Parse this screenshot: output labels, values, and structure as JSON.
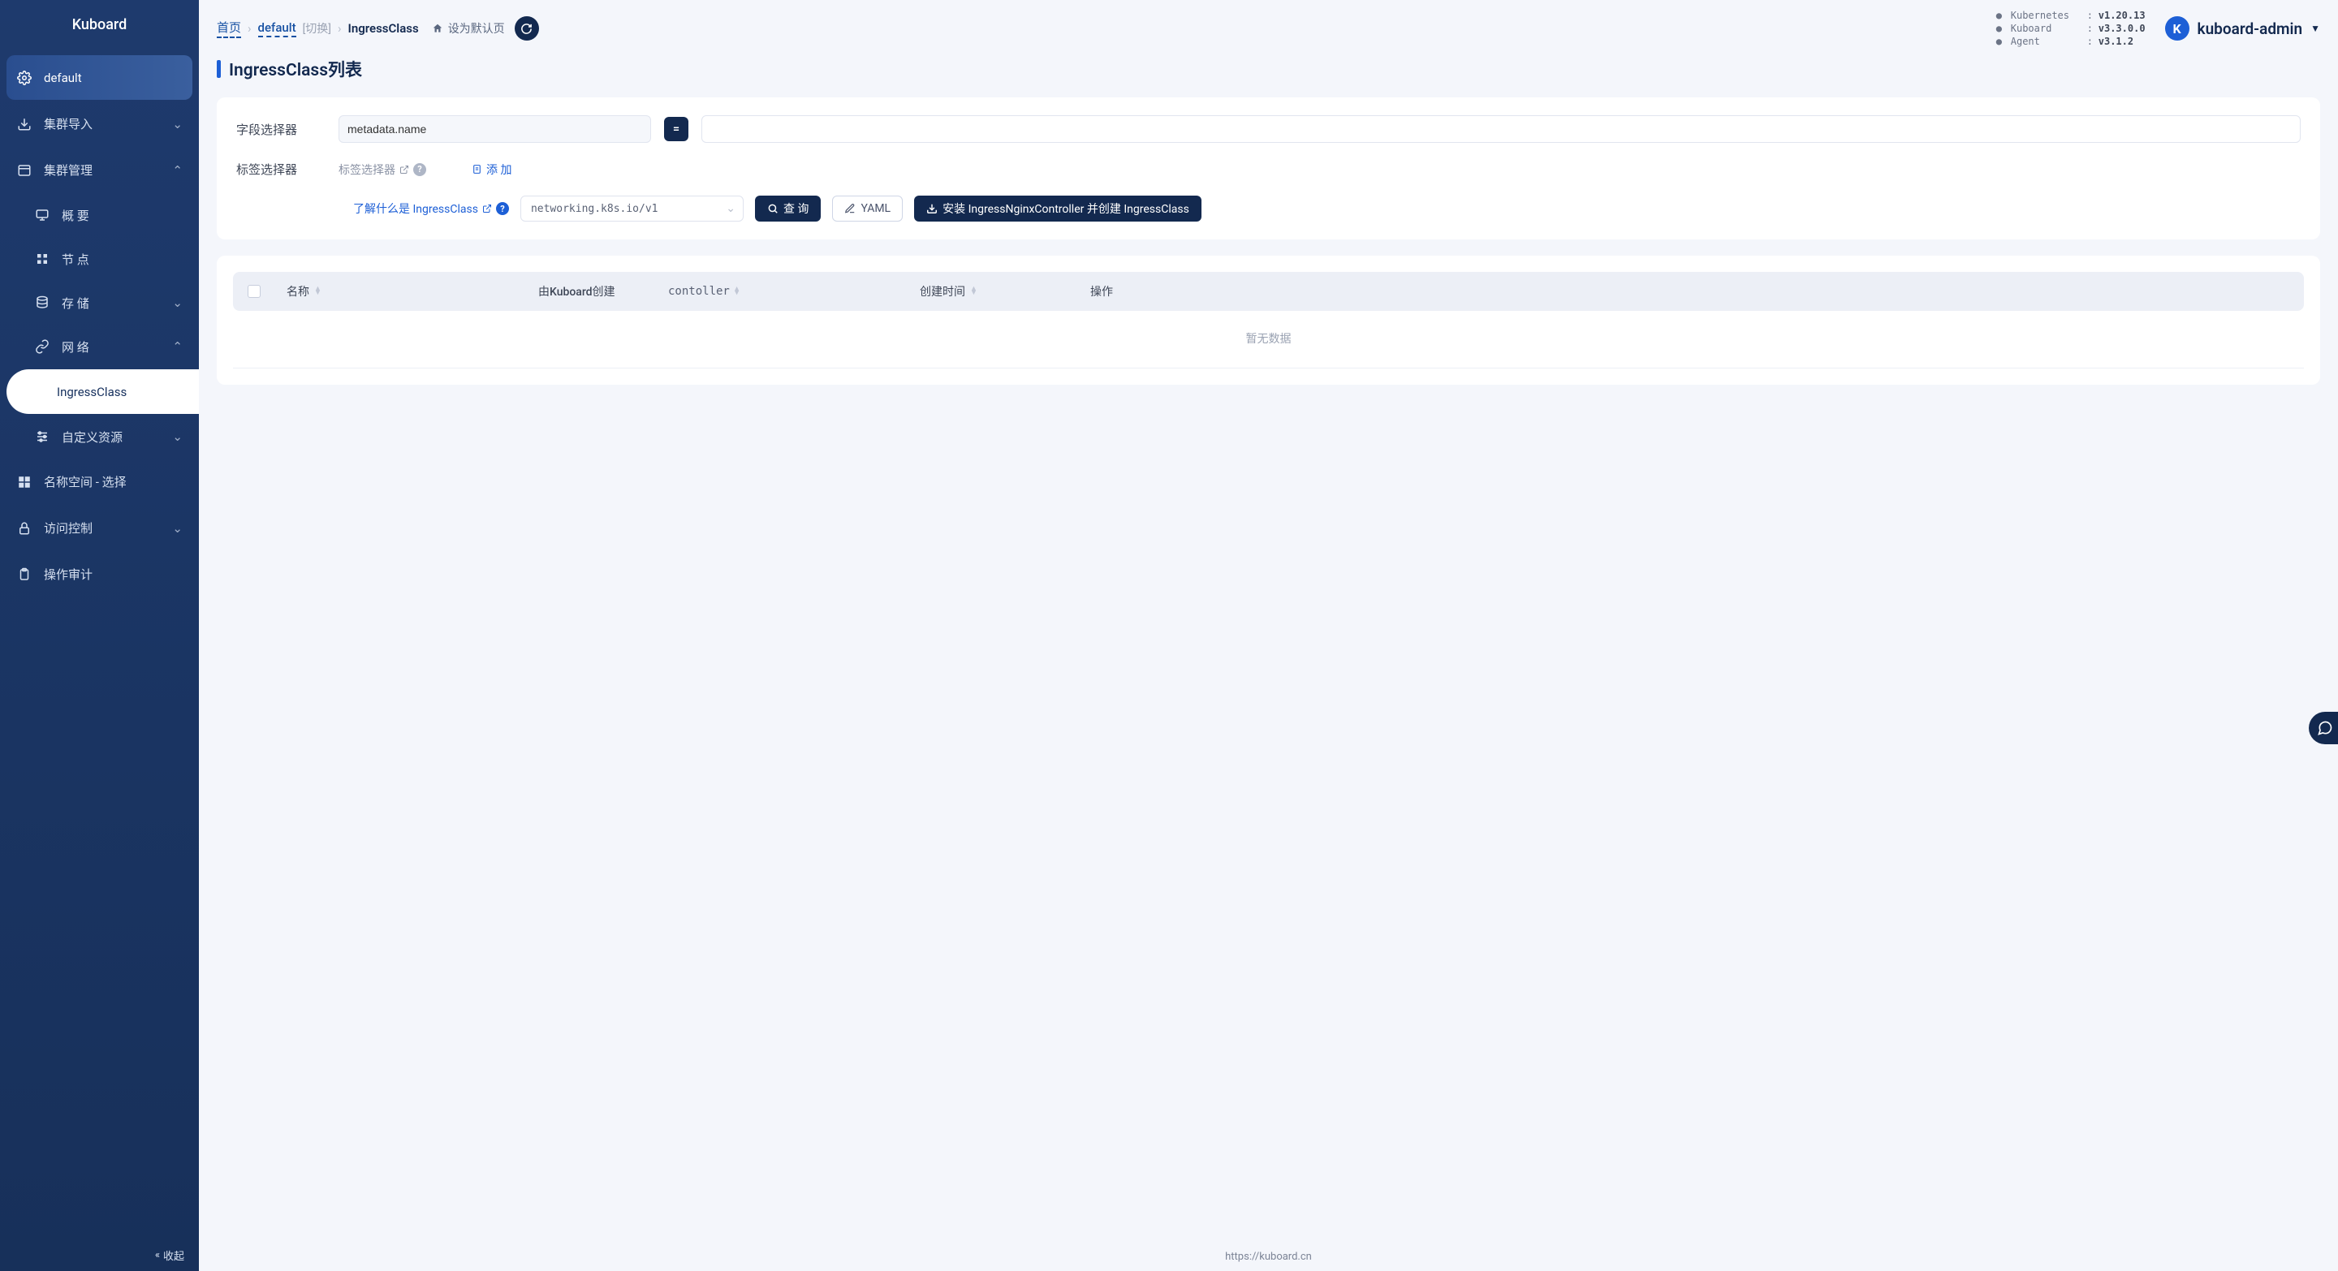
{
  "brand": "Kuboard",
  "sidebar": {
    "items": [
      {
        "label": "default",
        "icon": "gear",
        "active": true
      },
      {
        "label": "集群导入",
        "icon": "download",
        "expandable": true,
        "expanded": false
      },
      {
        "label": "集群管理",
        "icon": "window",
        "expandable": true,
        "expanded": true
      },
      {
        "label": "概 要",
        "icon": "monitor",
        "sub": true
      },
      {
        "label": "节 点",
        "icon": "grid",
        "sub": true
      },
      {
        "label": "存 储",
        "icon": "database",
        "sub": true,
        "expandable": true,
        "expanded": false
      },
      {
        "label": "网 络",
        "icon": "link",
        "sub": true,
        "expandable": true,
        "expanded": true
      },
      {
        "label": "IngressClass",
        "sub": true,
        "selected": true
      },
      {
        "label": "自定义资源",
        "icon": "sliders",
        "sub": true,
        "expandable": true,
        "expanded": false
      },
      {
        "label": "名称空间 - 选择",
        "icon": "apps"
      },
      {
        "label": "访问控制",
        "icon": "lock",
        "expandable": true,
        "expanded": false
      },
      {
        "label": "操作审计",
        "icon": "clipboard"
      }
    ],
    "collapse_label": "收起"
  },
  "breadcrumbs": {
    "home": "首页",
    "namespace": "default",
    "switch": "[切换]",
    "current": "IngressClass",
    "set_default": "设为默认页"
  },
  "versions": {
    "rows": [
      {
        "name": "Kubernetes",
        "value": "v1.20.13"
      },
      {
        "name": "Kuboard",
        "value": "v3.3.0.0"
      },
      {
        "name": "Agent",
        "value": "v3.1.2"
      }
    ]
  },
  "user": {
    "initial": "K",
    "name": "kuboard-admin"
  },
  "page": {
    "title": "IngressClass列表",
    "field_selector_label": "字段选择器",
    "field_selector_value": "metadata.name",
    "label_selector_label": "标签选择器",
    "label_selector_hint": "标签选择器",
    "add_label": "添 加",
    "learn_link": "了解什么是 IngressClass",
    "api_version": "networking.k8s.io/v1",
    "query_btn": "查 询",
    "yaml_btn": "YAML",
    "install_btn": "安装 IngressNginxController 并创建 IngressClass"
  },
  "table": {
    "columns": {
      "name": "名称",
      "created_by": "由Kuboard创建",
      "controller": "contoller",
      "created_at": "创建时间",
      "ops": "操作"
    },
    "empty": "暂无数据"
  },
  "footer": {
    "link": "https://kuboard.cn"
  }
}
